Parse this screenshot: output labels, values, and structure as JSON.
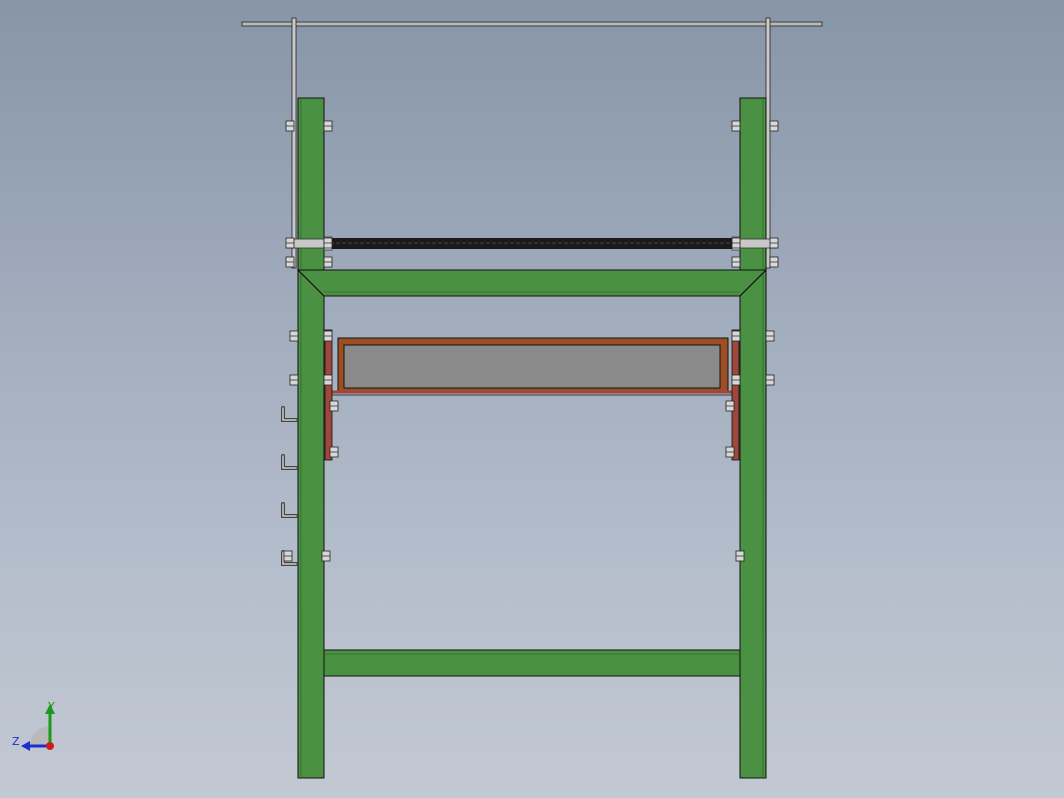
{
  "viewport": {
    "background_top": "#8795a8",
    "background_bottom": "#c3c9d3"
  },
  "model": {
    "frame_color": "#4b9144",
    "tray_frame_color": "#9c4f22",
    "tray_panel_color": "#8a8a8a",
    "bracket_color": "#a0473c",
    "roller_color": "#1a1a1a",
    "metal_color": "#b0b0b0",
    "outline_color": "#111111"
  },
  "triad": {
    "y_label": "Y",
    "z_label": "Z",
    "y_color": "#1a9a1a",
    "z_color": "#1a2fd0",
    "x_color": "#d01a1a"
  }
}
